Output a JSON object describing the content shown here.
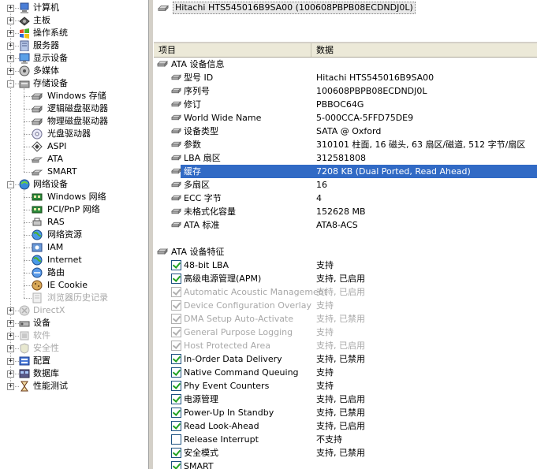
{
  "tree": {
    "items": [
      {
        "label": "计算机",
        "level": 0,
        "expander": "+",
        "icon": "computer-icon"
      },
      {
        "label": "主板",
        "level": 0,
        "expander": "+",
        "icon": "motherboard-icon"
      },
      {
        "label": "操作系统",
        "level": 0,
        "expander": "+",
        "icon": "windows-flag-icon"
      },
      {
        "label": "服务器",
        "level": 0,
        "expander": "+",
        "icon": "server-icon"
      },
      {
        "label": "显示设备",
        "level": 0,
        "expander": "+",
        "icon": "display-icon"
      },
      {
        "label": "多媒体",
        "level": 0,
        "expander": "+",
        "icon": "multimedia-icon"
      },
      {
        "label": "存储设备",
        "level": 0,
        "expander": "-",
        "icon": "storage-icon"
      },
      {
        "label": "Windows 存储",
        "level": 1,
        "icon": "drive-icon"
      },
      {
        "label": "逻辑磁盘驱动器",
        "level": 1,
        "icon": "drive-icon"
      },
      {
        "label": "物理磁盘驱动器",
        "level": 1,
        "icon": "drive-icon"
      },
      {
        "label": "光盘驱动器",
        "level": 1,
        "icon": "cdrom-icon"
      },
      {
        "label": "ASPI",
        "level": 1,
        "icon": "aspi-icon"
      },
      {
        "label": "ATA",
        "level": 1,
        "icon": "ata-icon",
        "selected": true
      },
      {
        "label": "SMART",
        "level": 1,
        "icon": "ata-icon"
      },
      {
        "label": "网络设备",
        "level": 0,
        "expander": "-",
        "icon": "network-icon"
      },
      {
        "label": "Windows 网络",
        "level": 1,
        "icon": "nic-icon"
      },
      {
        "label": "PCI/PnP 网络",
        "level": 1,
        "icon": "nic-icon"
      },
      {
        "label": "RAS",
        "level": 1,
        "icon": "ras-icon"
      },
      {
        "label": "网络资源",
        "level": 1,
        "icon": "globe-icon"
      },
      {
        "label": "IAM",
        "level": 1,
        "icon": "iam-icon"
      },
      {
        "label": "Internet",
        "level": 1,
        "icon": "globe-icon"
      },
      {
        "label": "路由",
        "level": 1,
        "icon": "route-icon"
      },
      {
        "label": "IE Cookie",
        "level": 1,
        "icon": "cookie-icon"
      },
      {
        "label": "浏览器历史记录",
        "level": 1,
        "icon": "history-icon",
        "disabled": true
      },
      {
        "label": "DirectX",
        "level": 0,
        "expander": "+",
        "icon": "directx-icon",
        "disabled": true
      },
      {
        "label": "设备",
        "level": 0,
        "expander": "+",
        "icon": "devices-icon"
      },
      {
        "label": "软件",
        "level": 0,
        "expander": "+",
        "icon": "software-icon",
        "disabled": true
      },
      {
        "label": "安全性",
        "level": 0,
        "expander": "+",
        "icon": "security-icon",
        "disabled": true
      },
      {
        "label": "配置",
        "level": 0,
        "expander": "+",
        "icon": "config-icon"
      },
      {
        "label": "数据库",
        "level": 0,
        "expander": "+",
        "icon": "database-icon"
      },
      {
        "label": "性能测试",
        "level": 0,
        "expander": "+",
        "icon": "hourglass-icon"
      }
    ]
  },
  "device": {
    "label": "Hitachi HTS545016B9SA00 (100608PBPB08ECDNDJ0L)"
  },
  "columns": {
    "property": "项目",
    "value": "数据"
  },
  "groups": [
    {
      "title": "ATA 设备信息",
      "rows": [
        {
          "name": "型号 ID",
          "value": "Hitachi HTS545016B9SA00"
        },
        {
          "name": "序列号",
          "value": "100608PBPB08ECDNDJ0L"
        },
        {
          "name": "修订",
          "value": "PBBOC64G"
        },
        {
          "name": "World Wide Name",
          "value": "5-000CCA-5FFD75DE9"
        },
        {
          "name": "设备类型",
          "value": "SATA @ Oxford"
        },
        {
          "name": "参数",
          "value": "310101 柱面, 16 磁头, 63 扇区/磁道, 512 字节/扇区"
        },
        {
          "name": "LBA 扇区",
          "value": "312581808"
        },
        {
          "name": "缓存",
          "value": "7208 KB (Dual Ported, Read Ahead)",
          "selected": true
        },
        {
          "name": "多扇区",
          "value": "16"
        },
        {
          "name": "ECC 字节",
          "value": "4"
        },
        {
          "name": "未格式化容量",
          "value": "152628 MB"
        },
        {
          "name": "ATA 标准",
          "value": "ATA8-ACS"
        }
      ]
    },
    {
      "title": "ATA 设备特征",
      "rows": [
        {
          "name": "48-bit LBA",
          "value": "支持",
          "checked": true
        },
        {
          "name": "高级电源管理(APM)",
          "value": "支持, 已启用",
          "checked": true
        },
        {
          "name": "Automatic Acoustic Management",
          "value": "支持, 已启用",
          "checked": true,
          "grey": true
        },
        {
          "name": "Device Configuration Overlay",
          "value": "支持",
          "checked": true,
          "grey": true
        },
        {
          "name": "DMA Setup Auto-Activate",
          "value": "支持, 已禁用",
          "checked": true,
          "grey": true
        },
        {
          "name": "General Purpose Logging",
          "value": "支持",
          "checked": true,
          "grey": true
        },
        {
          "name": "Host Protected Area",
          "value": "支持, 已启用",
          "checked": true,
          "grey": true
        },
        {
          "name": "In-Order Data Delivery",
          "value": "支持, 已禁用",
          "checked": true
        },
        {
          "name": "Native Command Queuing",
          "value": "支持",
          "checked": true
        },
        {
          "name": "Phy Event Counters",
          "value": "支持",
          "checked": true
        },
        {
          "name": "电源管理",
          "value": "支持, 已启用",
          "checked": true
        },
        {
          "name": "Power-Up In Standby",
          "value": "支持, 已禁用",
          "checked": true
        },
        {
          "name": "Read Look-Ahead",
          "value": "支持, 已启用",
          "checked": true
        },
        {
          "name": "Release Interrupt",
          "value": "不支持",
          "checked": false
        },
        {
          "name": "安全模式",
          "value": "支持, 已禁用",
          "checked": true
        },
        {
          "name": "SMART",
          "value": "",
          "checked": true
        }
      ]
    }
  ]
}
